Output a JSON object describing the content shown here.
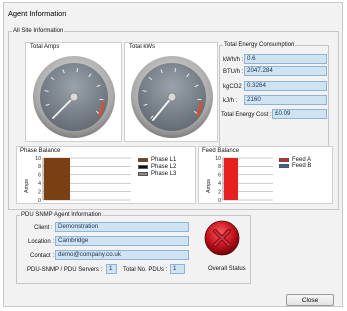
{
  "window": {
    "title": "Agent Information"
  },
  "all_site": {
    "legend": "All Site Information",
    "total_amps": {
      "title": "Total Amps"
    },
    "total_kw": {
      "title": "Total kWs"
    },
    "energy": {
      "title": "Total Energy Consumption",
      "rows": [
        {
          "label": "kWh/h :",
          "value": "0.6"
        },
        {
          "label": "BTU/h :",
          "value": "2047.284"
        },
        {
          "label": "kgCO2 :",
          "value": "0.3264"
        },
        {
          "label": "kJ/h :",
          "value": "2160"
        }
      ],
      "cost_label": "Total Energy Cost :",
      "cost_value": "£0.09"
    },
    "phase_balance": {
      "title": "Phase Balance",
      "ylabel": "Amps",
      "legend": [
        {
          "name": "Phase L1",
          "color": "#7a3f12"
        },
        {
          "name": "Phase L2",
          "color": "#111111"
        },
        {
          "name": "Phase L3",
          "color": "#8a8a8a"
        }
      ]
    },
    "feed_balance": {
      "title": "Feed Balance",
      "ylabel": "Amps",
      "legend": [
        {
          "name": "Feed A",
          "color": "#e62020"
        },
        {
          "name": "Feed B",
          "color": "#3a5fb0"
        }
      ]
    }
  },
  "pdu": {
    "legend": "PDU SNMP Agent Information",
    "client_label": "Client :",
    "client_value": "Demonstration",
    "location_label": "Location :",
    "location_value": "Cambridge",
    "contact_label": "Contact :",
    "contact_value": "demo@company.co.uk",
    "servers_label": "PDU-SNMP / PDU Servers :",
    "servers_value": "1",
    "pdus_label": "Total No. PDUs :",
    "pdus_value": "1",
    "status_label": "Overall Status",
    "status_color": "#c4121c",
    "status_icon": "x-icon"
  },
  "buttons": {
    "close": "Close"
  },
  "chart_data": [
    {
      "type": "bar",
      "title": "Phase Balance",
      "ylabel": "Amps",
      "ylim": [
        0,
        10
      ],
      "yticks": [
        "10",
        "8",
        "6",
        "4",
        "2",
        "0"
      ],
      "series": [
        {
          "name": "Phase L1",
          "values": [
            10
          ]
        },
        {
          "name": "Phase L2",
          "values": [
            0
          ]
        },
        {
          "name": "Phase L3",
          "values": [
            0
          ]
        }
      ]
    },
    {
      "type": "bar",
      "title": "Feed Balance",
      "ylabel": "Amps",
      "ylim": [
        0,
        10
      ],
      "yticks": [
        "10",
        "8",
        "6",
        "4",
        "2",
        "0"
      ],
      "series": [
        {
          "name": "Feed A",
          "values": [
            10
          ]
        },
        {
          "name": "Feed B",
          "values": [
            0
          ]
        }
      ]
    }
  ]
}
